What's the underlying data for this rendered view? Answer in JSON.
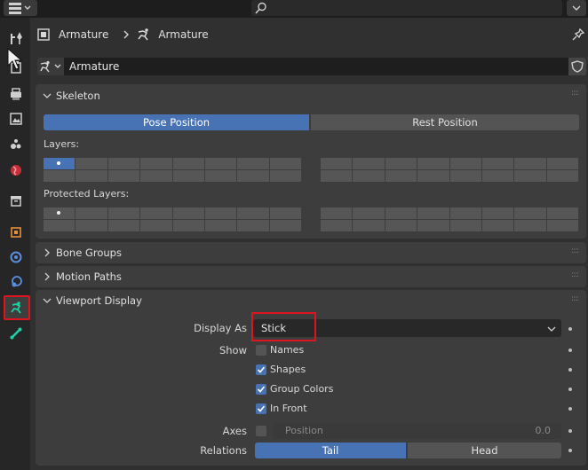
{
  "breadcrumb": {
    "object": "Armature",
    "data": "Armature"
  },
  "datablock": {
    "name": "Armature"
  },
  "skeleton": {
    "title": "Skeleton",
    "pose_position": "Pose Position",
    "rest_position": "Rest Position",
    "layers_label": "Layers:",
    "protected_layers_label": "Protected Layers:"
  },
  "bone_groups": {
    "title": "Bone Groups"
  },
  "motion_paths": {
    "title": "Motion Paths"
  },
  "viewport_display": {
    "title": "Viewport Display",
    "display_as_label": "Display As",
    "display_as_value": "Stick",
    "show_label": "Show",
    "names": "Names",
    "names_checked": false,
    "shapes": "Shapes",
    "shapes_checked": true,
    "group_colors": "Group Colors",
    "group_colors_checked": true,
    "in_front": "In Front",
    "in_front_checked": true,
    "axes_label": "Axes",
    "axes_checked": false,
    "position_label": "Position",
    "position_value": "0.0",
    "relations_label": "Relations",
    "tail": "Tail",
    "head": "Head"
  },
  "colors": {
    "accent": "#4772b3",
    "highlight": "#e0141e",
    "armature_icon": "#1fd2a6"
  },
  "icons": [
    "tool-icon",
    "render-icon",
    "output-icon",
    "view-layer-icon",
    "scene-icon",
    "world-icon",
    "collection-icon",
    "object-icon",
    "modifiers-icon",
    "physics-icon",
    "armature-data-icon",
    "bone-icon"
  ]
}
